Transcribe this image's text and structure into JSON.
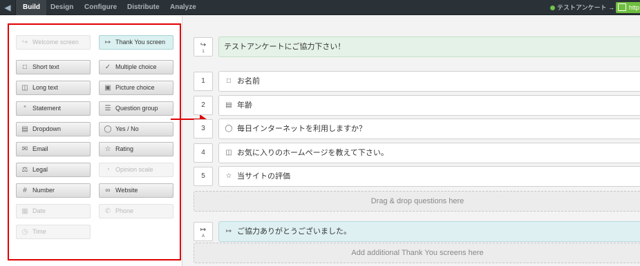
{
  "nav": {
    "tabs": [
      "Build",
      "Design",
      "Configure",
      "Distribute",
      "Analyze"
    ],
    "active_tab": "Build",
    "survey_link": "テストアンケート →",
    "url_button": "http"
  },
  "palette": {
    "items": [
      {
        "label": "Welcome screen",
        "icon": "welcome-icon",
        "state": "disabled"
      },
      {
        "label": "Thank You screen",
        "icon": "thankyou-icon",
        "state": "selected"
      },
      {
        "label": "Short text",
        "icon": "short-text-icon",
        "state": "normal"
      },
      {
        "label": "Multiple choice",
        "icon": "checkbox-icon",
        "state": "normal"
      },
      {
        "label": "Long text",
        "icon": "long-text-icon",
        "state": "normal"
      },
      {
        "label": "Picture choice",
        "icon": "picture-icon",
        "state": "normal"
      },
      {
        "label": "Statement",
        "icon": "quote-icon",
        "state": "normal"
      },
      {
        "label": "Question group",
        "icon": "group-icon",
        "state": "normal"
      },
      {
        "label": "Dropdown",
        "icon": "dropdown-icon",
        "state": "normal"
      },
      {
        "label": "Yes / No",
        "icon": "yes-no-icon",
        "state": "normal"
      },
      {
        "label": "Email",
        "icon": "email-icon",
        "state": "normal"
      },
      {
        "label": "Rating",
        "icon": "star-icon",
        "state": "normal"
      },
      {
        "label": "Legal",
        "icon": "scales-icon",
        "state": "normal"
      },
      {
        "label": "Opinion scale",
        "icon": "scale-icon",
        "state": "disabled"
      },
      {
        "label": "Number",
        "icon": "number-icon",
        "state": "normal"
      },
      {
        "label": "Website",
        "icon": "link-icon",
        "state": "normal"
      },
      {
        "label": "Date",
        "icon": "calendar-icon",
        "state": "disabled"
      },
      {
        "label": "Phone",
        "icon": "phone-icon",
        "state": "disabled"
      },
      {
        "label": "Time",
        "icon": "clock-icon",
        "state": "disabled"
      }
    ]
  },
  "welcome": {
    "badge_number": "1",
    "text": "テストアンケートにご協力下さい！"
  },
  "questions": [
    {
      "number": "1",
      "icon": "short-text-icon",
      "text": "お名前"
    },
    {
      "number": "2",
      "icon": "dropdown-icon",
      "text": "年齢"
    },
    {
      "number": "3",
      "icon": "yes-no-icon",
      "text": "毎日インターネットを利用しますか？"
    },
    {
      "number": "4",
      "icon": "long-text-icon",
      "text": "お気に入りのホームページを教えて下さい。"
    },
    {
      "number": "5",
      "icon": "star-icon",
      "text": "当サイトの評価"
    }
  ],
  "drop_zone": "Drag & drop questions here",
  "thankyou": {
    "badge_letter": "A",
    "text": "ご協力ありがとうございました。"
  },
  "add_thankyou": "Add additional Thank You screens here",
  "colors": {
    "highlight_border": "#e00000",
    "accent_green": "#6fbf3e",
    "nav_bg": "#2b3237"
  }
}
